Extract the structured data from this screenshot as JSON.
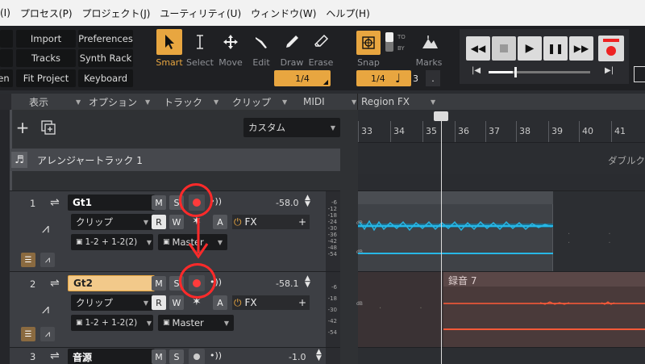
{
  "menu": [
    "(I)",
    "プロセス(P)",
    "プロジェクト(J)",
    "ユーティリティ(U)",
    "ウィンドウ(W)",
    "ヘルプ(H)"
  ],
  "toolbar": {
    "left_buttons": [
      "Import",
      "Preferences",
      "Tracks",
      "Synth Rack",
      "nen",
      "Fit Project",
      "Keyboard"
    ],
    "tools": [
      "Smart",
      "Select",
      "Move",
      "Edit",
      "Draw",
      "Erase"
    ],
    "tool_icons": [
      "cursor-arrow-icon",
      "i-beam-icon",
      "move-cross-icon",
      "edit-knife-icon",
      "draw-pencil-icon",
      "erase-icon"
    ],
    "tool_fraction": "1/4",
    "snap_label": "Snap",
    "snap_value": "1/4",
    "snap_to": "TO",
    "snap_by": "BY",
    "snap_num": "3",
    "marks_label": "Marks"
  },
  "sections": [
    "表示",
    "オプション",
    "トラック",
    "クリップ",
    "MIDI",
    "Region FX"
  ],
  "left": {
    "preset": "カスタム",
    "arranger_label": "アレンジャートラック 1",
    "tracks": [
      {
        "num": "1",
        "name": "Gt1",
        "volume": "-58.0",
        "clip": "クリップ",
        "fx": "FX",
        "input": "1-2 + 1-2(2)",
        "output": "Master",
        "selected": false
      },
      {
        "num": "2",
        "name": "Gt2",
        "volume": "-58.1",
        "clip": "クリップ",
        "fx": "FX",
        "input": "1-2 + 1-2(2)",
        "output": "Master",
        "selected": true
      },
      {
        "num": "3",
        "name": "音源",
        "volume": "-1.0",
        "selected": false
      }
    ],
    "meter_scale": [
      "-6",
      "-12",
      "-18",
      "-24",
      "-30",
      "-36",
      "-42",
      "-48",
      "-54"
    ],
    "meter_scale_short": [
      "-6",
      "-18",
      "-30",
      "-42",
      "-54"
    ]
  },
  "buttons": {
    "m": "M",
    "s": "S",
    "r": "R",
    "w": "W",
    "a": "A",
    "plus": "+"
  },
  "ruler": {
    "ticks": [
      "33",
      "34",
      "35",
      "36",
      "37",
      "38",
      "39",
      "40",
      "41"
    ]
  },
  "arrangement": {
    "arranger_text": "ダブルク",
    "clip_label": "録音 7"
  },
  "colors": {
    "accent": "#e8a640",
    "record": "#ff3b3b",
    "wave_blue": "#27b7e6",
    "wave_red": "#ff5a38",
    "annot_red": "#ff2a2a"
  }
}
